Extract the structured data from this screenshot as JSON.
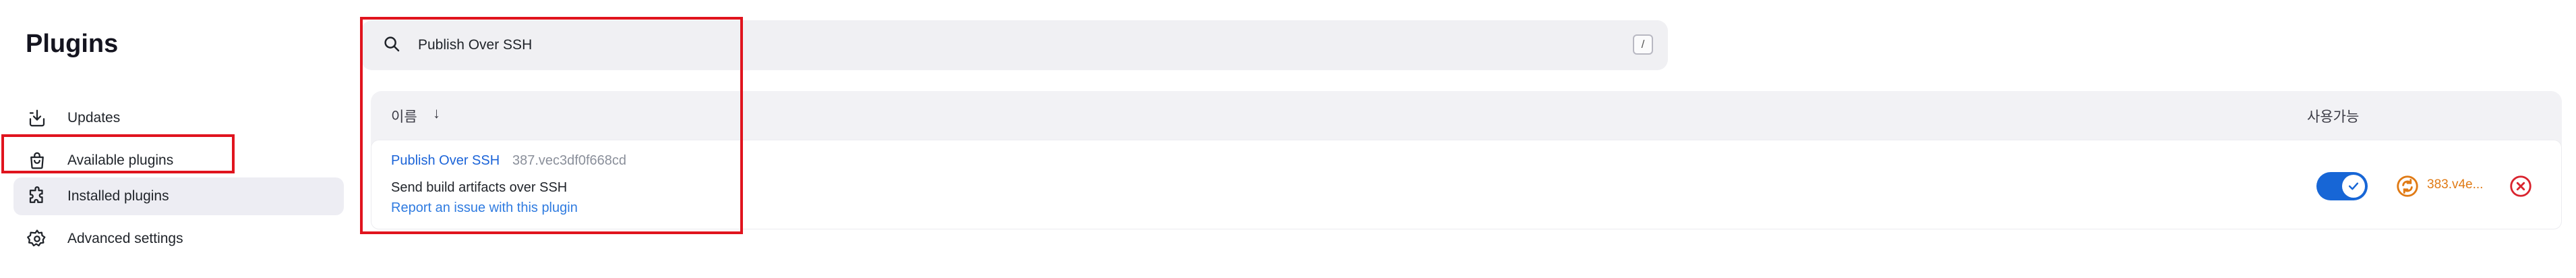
{
  "sidebar": {
    "title": "Plugins",
    "items": [
      {
        "label": "Updates",
        "icon": "download-icon"
      },
      {
        "label": "Available plugins",
        "icon": "shopping-bag-icon"
      },
      {
        "label": "Installed plugins",
        "icon": "puzzle-icon"
      },
      {
        "label": "Advanced settings",
        "icon": "gear-icon"
      }
    ],
    "active_index": 2
  },
  "search": {
    "value": "Publish Over SSH",
    "shortcut": "/"
  },
  "table": {
    "col_name": "이름",
    "sort_arrow": "↓",
    "col_enabled": "사용가능",
    "rows": [
      {
        "name": "Publish Over SSH",
        "version": "387.vec3df0f668cd",
        "description": "Send build artifacts over SSH",
        "report_link": "Report an issue with this plugin",
        "enabled": true,
        "update_version": "383.v4e...",
        "colors": {
          "toggle": "#1766d6",
          "update": "#e07a14",
          "remove": "#d9232e"
        }
      }
    ]
  },
  "colors": {
    "highlight_box": "#e0141e",
    "link": "#1a63d8"
  }
}
